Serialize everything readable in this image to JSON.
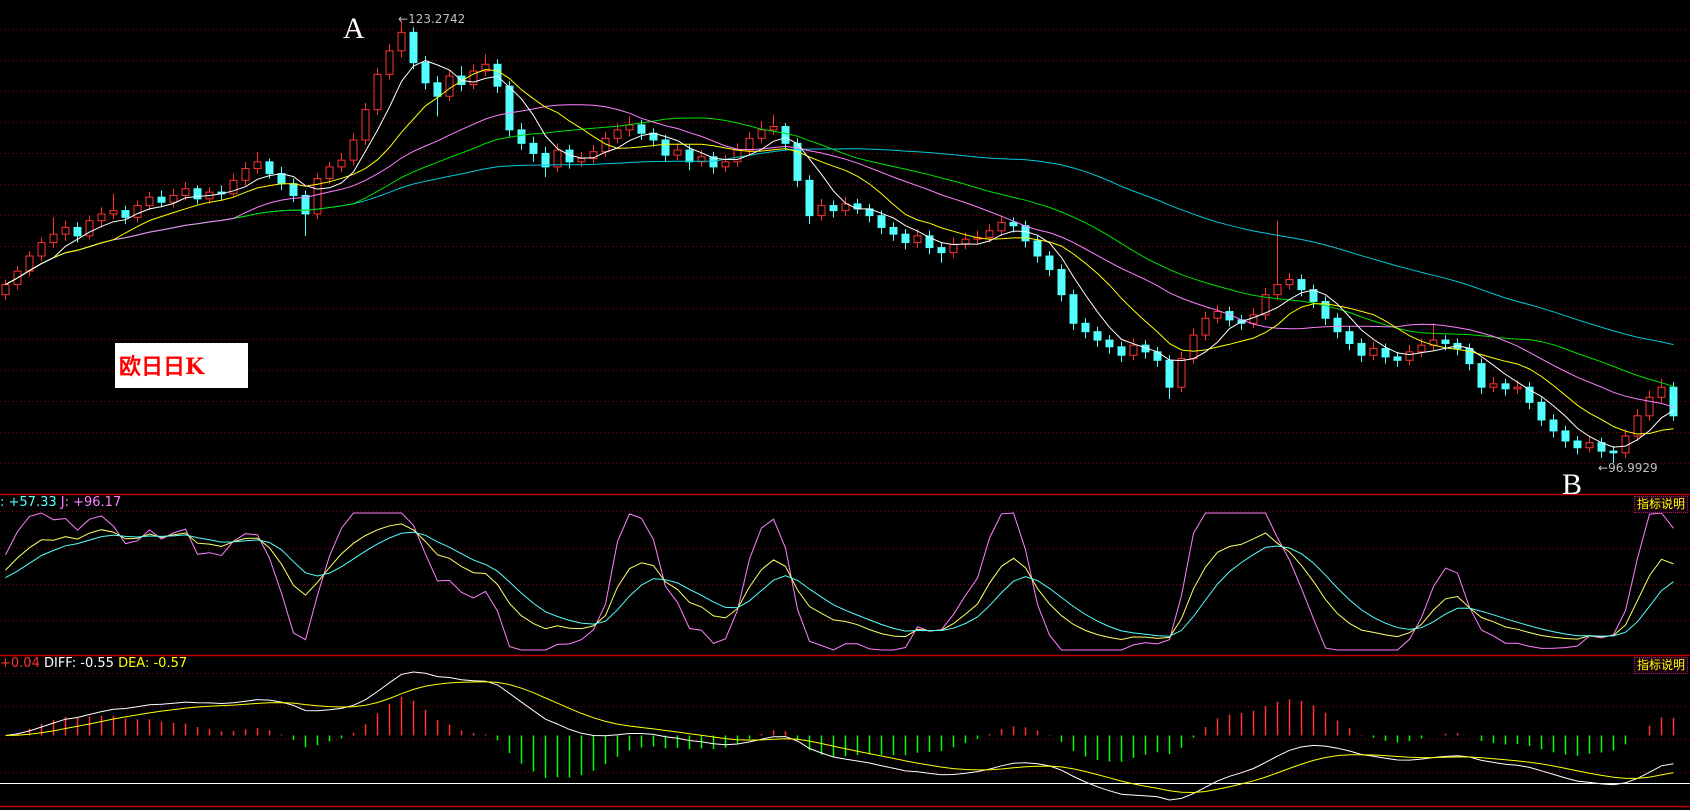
{
  "title": "欧日日K",
  "annotations": {
    "peak_marker": "A",
    "trough_marker": "B",
    "high_label": "123.2742",
    "low_label": "96.9929"
  },
  "kdj_panel": {
    "label_partial": ": +57.33",
    "j_label": "J: +96.17",
    "help_button": "指标说明"
  },
  "macd_panel": {
    "macd_value": "+0.04",
    "diff_label": "DIFF: -0.55",
    "dea_label": "DEA: -0.57",
    "help_button": "指标说明"
  },
  "colors": {
    "up": "#ff3232",
    "down": "#54ffff",
    "ma5": "#ffffff",
    "ma10": "#ffff00",
    "ma20": "#ff80ff",
    "ma30": "#00e000",
    "ma60": "#00c8d8",
    "grid": "#900000",
    "separator": "#c00000",
    "kdj_k": "#ffff66",
    "kdj_d": "#54ffff",
    "kdj_j": "#ff80ff",
    "diff": "#ffffff",
    "dea": "#ffff00",
    "hist_up": "#ff3232",
    "hist_down": "#00ff00"
  },
  "chart_data": {
    "type": "candlestick",
    "title": "欧日日K",
    "ylim": [
      96.9929,
      123.2742
    ],
    "grid": true,
    "moving_averages": [
      5,
      10,
      20,
      30,
      60
    ],
    "indicators": [
      "KDJ",
      "MACD"
    ],
    "ohlc": [
      [
        107.0,
        107.9,
        106.7,
        107.6
      ],
      [
        107.6,
        108.7,
        107.3,
        108.4
      ],
      [
        108.4,
        109.6,
        108.1,
        109.3
      ],
      [
        109.3,
        110.4,
        109.0,
        110.1
      ],
      [
        110.1,
        111.6,
        109.8,
        110.6
      ],
      [
        110.6,
        111.4,
        110.2,
        111.0
      ],
      [
        111.0,
        111.3,
        110.1,
        110.5
      ],
      [
        110.5,
        111.7,
        110.3,
        111.4
      ],
      [
        111.4,
        112.2,
        111.0,
        111.8
      ],
      [
        111.8,
        113.0,
        111.5,
        112.0
      ],
      [
        112.0,
        112.3,
        111.2,
        111.6
      ],
      [
        111.6,
        112.6,
        111.3,
        112.3
      ],
      [
        112.3,
        113.1,
        112.0,
        112.8
      ],
      [
        112.8,
        113.2,
        112.2,
        112.5
      ],
      [
        112.5,
        113.3,
        112.2,
        112.9
      ],
      [
        112.9,
        113.7,
        112.6,
        113.3
      ],
      [
        113.3,
        113.5,
        112.4,
        112.7
      ],
      [
        112.7,
        113.4,
        112.4,
        113.1
      ],
      [
        113.1,
        113.5,
        112.6,
        113.0
      ],
      [
        113.0,
        114.2,
        112.8,
        113.8
      ],
      [
        113.8,
        114.9,
        113.5,
        114.5
      ],
      [
        114.5,
        115.5,
        114.2,
        114.9
      ],
      [
        114.9,
        115.1,
        113.9,
        114.2
      ],
      [
        114.2,
        114.6,
        113.2,
        113.6
      ],
      [
        113.6,
        113.9,
        112.5,
        112.9
      ],
      [
        112.9,
        113.2,
        110.5,
        111.8
      ],
      [
        111.8,
        114.2,
        111.5,
        113.9
      ],
      [
        113.9,
        114.9,
        113.6,
        114.6
      ],
      [
        114.6,
        115.4,
        114.3,
        115.0
      ],
      [
        115.0,
        116.6,
        114.7,
        116.2
      ],
      [
        116.2,
        118.4,
        115.9,
        118.0
      ],
      [
        118.0,
        120.5,
        117.7,
        120.1
      ],
      [
        120.1,
        121.9,
        119.8,
        121.5
      ],
      [
        121.5,
        123.2742,
        121.1,
        122.6
      ],
      [
        122.6,
        122.9,
        120.4,
        120.8
      ],
      [
        120.8,
        121.2,
        119.2,
        119.6
      ],
      [
        119.6,
        120.0,
        117.6,
        118.8
      ],
      [
        118.8,
        120.4,
        118.5,
        120.0
      ],
      [
        120.0,
        120.6,
        119.1,
        119.5
      ],
      [
        119.5,
        120.7,
        119.2,
        120.3
      ],
      [
        120.3,
        121.3,
        120.0,
        120.7
      ],
      [
        120.7,
        121.0,
        119.0,
        119.4
      ],
      [
        119.4,
        119.7,
        116.4,
        116.8
      ],
      [
        116.8,
        117.2,
        115.6,
        116.0
      ],
      [
        116.0,
        116.4,
        114.9,
        115.4
      ],
      [
        115.4,
        115.8,
        114.0,
        114.6
      ],
      [
        114.6,
        116.0,
        114.3,
        115.6
      ],
      [
        115.6,
        115.9,
        114.5,
        114.9
      ],
      [
        114.9,
        115.5,
        114.6,
        115.1
      ],
      [
        115.1,
        115.9,
        114.8,
        115.5
      ],
      [
        115.5,
        116.7,
        115.2,
        116.3
      ],
      [
        116.3,
        117.2,
        116.0,
        116.8
      ],
      [
        116.8,
        117.6,
        116.4,
        117.1
      ],
      [
        117.1,
        117.4,
        116.2,
        116.6
      ],
      [
        116.6,
        116.9,
        115.8,
        116.2
      ],
      [
        116.2,
        116.5,
        114.9,
        115.3
      ],
      [
        115.3,
        116.0,
        115.0,
        115.6
      ],
      [
        115.6,
        115.9,
        114.4,
        114.9
      ],
      [
        114.9,
        115.6,
        114.6,
        115.2
      ],
      [
        115.2,
        115.5,
        114.2,
        114.6
      ],
      [
        114.6,
        115.3,
        114.3,
        114.9
      ],
      [
        114.9,
        116.0,
        114.6,
        115.6
      ],
      [
        115.6,
        116.7,
        115.3,
        116.3
      ],
      [
        116.3,
        117.3,
        116.0,
        116.8
      ],
      [
        116.8,
        117.7,
        116.5,
        117.0
      ],
      [
        117.0,
        117.2,
        115.6,
        116.0
      ],
      [
        116.0,
        116.3,
        113.4,
        113.8
      ],
      [
        113.8,
        114.1,
        111.2,
        111.7
      ],
      [
        111.7,
        112.7,
        111.4,
        112.3
      ],
      [
        112.3,
        112.6,
        111.6,
        112.0
      ],
      [
        112.0,
        112.8,
        111.7,
        112.4
      ],
      [
        112.4,
        112.7,
        111.8,
        112.1
      ],
      [
        112.1,
        112.4,
        111.3,
        111.7
      ],
      [
        111.7,
        112.0,
        110.6,
        111.0
      ],
      [
        111.0,
        111.3,
        110.2,
        110.6
      ],
      [
        110.6,
        110.9,
        109.7,
        110.1
      ],
      [
        110.1,
        110.9,
        109.8,
        110.5
      ],
      [
        110.5,
        110.8,
        109.4,
        109.8
      ],
      [
        109.8,
        110.1,
        108.9,
        109.5
      ],
      [
        109.5,
        110.4,
        109.2,
        110.0
      ],
      [
        110.0,
        110.7,
        109.7,
        110.3
      ],
      [
        110.3,
        110.8,
        110.0,
        110.4
      ],
      [
        110.4,
        111.2,
        110.1,
        110.8
      ],
      [
        110.8,
        111.7,
        110.5,
        111.3
      ],
      [
        111.3,
        111.6,
        110.7,
        111.1
      ],
      [
        111.1,
        111.4,
        109.8,
        110.2
      ],
      [
        110.2,
        110.5,
        108.9,
        109.3
      ],
      [
        109.3,
        109.6,
        108.1,
        108.5
      ],
      [
        108.5,
        108.8,
        106.6,
        107.0
      ],
      [
        107.0,
        107.3,
        104.9,
        105.3
      ],
      [
        105.3,
        105.6,
        104.4,
        104.8
      ],
      [
        104.8,
        105.1,
        103.9,
        104.3
      ],
      [
        104.3,
        104.6,
        103.5,
        103.9
      ],
      [
        103.9,
        104.2,
        103.0,
        103.4
      ],
      [
        103.4,
        104.4,
        103.1,
        104.0
      ],
      [
        104.0,
        104.3,
        103.2,
        103.6
      ],
      [
        103.6,
        103.9,
        102.7,
        103.1
      ],
      [
        103.1,
        103.4,
        100.8,
        101.5
      ],
      [
        101.5,
        103.6,
        101.2,
        103.2
      ],
      [
        103.2,
        105.0,
        102.9,
        104.6
      ],
      [
        104.6,
        106.0,
        104.3,
        105.6
      ],
      [
        105.6,
        106.4,
        105.3,
        106.0
      ],
      [
        106.0,
        106.3,
        105.1,
        105.5
      ],
      [
        105.5,
        105.8,
        104.9,
        105.3
      ],
      [
        105.3,
        106.2,
        105.0,
        105.8
      ],
      [
        105.8,
        107.4,
        105.5,
        107.0
      ],
      [
        107.0,
        111.4,
        106.7,
        107.6
      ],
      [
        107.6,
        108.3,
        107.3,
        107.9
      ],
      [
        107.9,
        108.2,
        106.9,
        107.3
      ],
      [
        107.3,
        107.6,
        106.2,
        106.6
      ],
      [
        106.6,
        106.9,
        105.2,
        105.6
      ],
      [
        105.6,
        105.9,
        104.4,
        104.8
      ],
      [
        104.8,
        105.1,
        103.7,
        104.1
      ],
      [
        104.1,
        104.4,
        103.0,
        103.4
      ],
      [
        103.4,
        104.2,
        103.1,
        103.8
      ],
      [
        103.8,
        104.1,
        102.9,
        103.3
      ],
      [
        103.3,
        103.6,
        102.7,
        103.1
      ],
      [
        103.1,
        104.0,
        102.8,
        103.6
      ],
      [
        103.6,
        104.4,
        103.3,
        104.0
      ],
      [
        104.0,
        105.3,
        103.7,
        104.3
      ],
      [
        104.3,
        104.6,
        103.7,
        104.1
      ],
      [
        104.1,
        104.4,
        103.4,
        103.8
      ],
      [
        103.8,
        104.1,
        102.5,
        102.9
      ],
      [
        102.9,
        103.2,
        101.1,
        101.5
      ],
      [
        101.5,
        102.1,
        101.2,
        101.7
      ],
      [
        101.7,
        102.0,
        101.0,
        101.4
      ],
      [
        101.4,
        101.9,
        101.1,
        101.5
      ],
      [
        101.5,
        101.8,
        100.2,
        100.6
      ],
      [
        100.6,
        100.9,
        99.2,
        99.55
      ],
      [
        99.55,
        99.9,
        98.5,
        98.9
      ],
      [
        98.9,
        99.2,
        97.9,
        98.3
      ],
      [
        98.3,
        98.6,
        97.5,
        97.9
      ],
      [
        97.9,
        98.6,
        97.6,
        98.2
      ],
      [
        98.2,
        98.5,
        97.3,
        97.7
      ],
      [
        97.7,
        98.0,
        96.9929,
        97.6
      ],
      [
        97.6,
        99.0,
        97.3,
        98.6
      ],
      [
        98.6,
        100.2,
        98.3,
        99.8
      ],
      [
        99.8,
        101.3,
        99.5,
        100.9
      ],
      [
        100.9,
        102.0,
        100.6,
        101.5
      ],
      [
        101.5,
        101.8,
        99.5,
        99.8
      ]
    ]
  }
}
